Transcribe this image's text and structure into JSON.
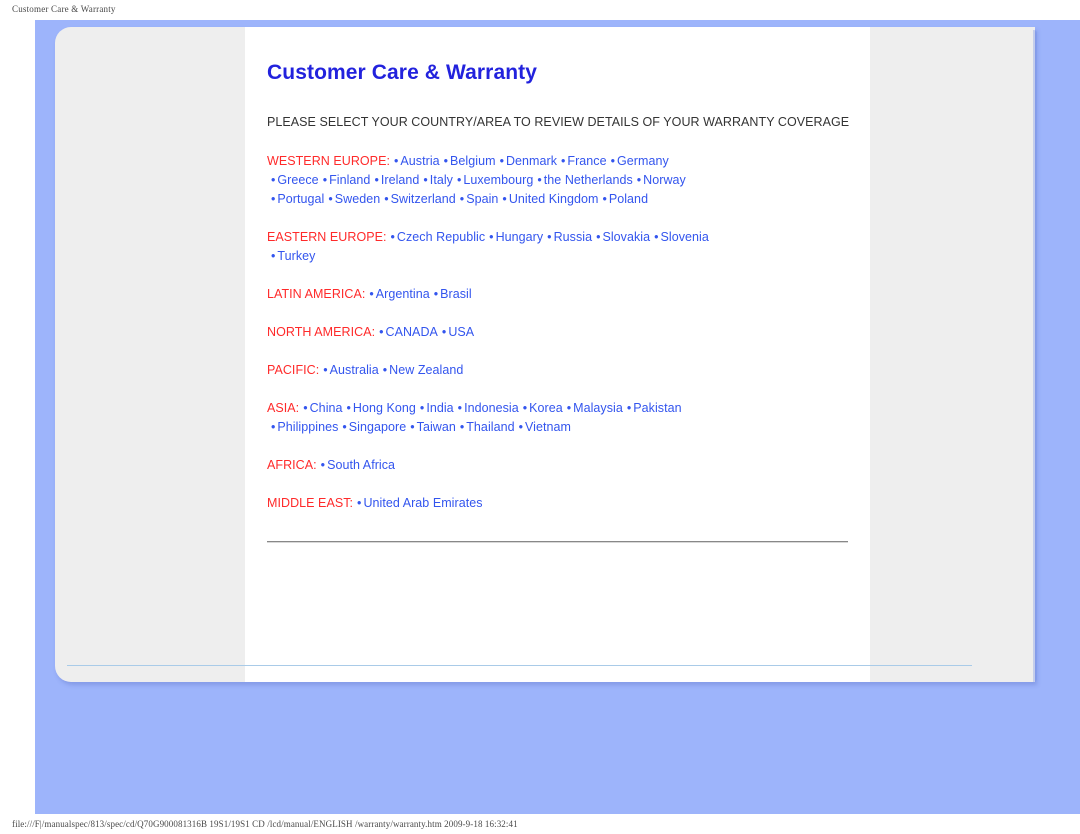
{
  "browser": {
    "header_title": "Customer Care & Warranty",
    "footer_text": "file:///F|/manualspec/813/spec/cd/Q70G900081316B 19S1/19S1 CD /lcd/manual/ENGLISH /warranty/warranty.htm 2009-9-18 16:32:41"
  },
  "colors": {
    "page_background": "#9db4fb",
    "card_background": "#eeeeee",
    "content_background": "#ffffff",
    "title": "#2222dd",
    "region_label": "#ff2a2a",
    "link": "#3355ee",
    "subtitle": "#333333",
    "rule": "#888888",
    "bottom_rule": "#a9cbe8"
  },
  "document": {
    "title": "Customer Care & Warranty",
    "subtitle": "PLEASE SELECT YOUR COUNTRY/AREA TO REVIEW DETAILS OF YOUR WARRANTY COVERAGE",
    "bullet": "•",
    "regions": [
      {
        "label": "WESTERN EUROPE:",
        "lines": [
          [
            "Austria",
            "Belgium",
            "Denmark",
            "France",
            "Germany"
          ],
          [
            "Greece",
            "Finland",
            "Ireland",
            "Italy",
            "Luxembourg",
            "the Netherlands",
            "Norway"
          ],
          [
            "Portugal",
            "Sweden",
            "Switzerland",
            "Spain",
            "United Kingdom",
            "Poland"
          ]
        ]
      },
      {
        "label": "EASTERN EUROPE:",
        "lines": [
          [
            "Czech Republic",
            "Hungary",
            "Russia",
            "Slovakia",
            "Slovenia"
          ],
          [
            "Turkey"
          ]
        ]
      },
      {
        "label": "LATIN AMERICA:",
        "lines": [
          [
            "Argentina",
            "Brasil"
          ]
        ]
      },
      {
        "label": "NORTH AMERICA:",
        "lines": [
          [
            "CANADA",
            "USA"
          ]
        ]
      },
      {
        "label": "PACIFIC:",
        "lines": [
          [
            "Australia",
            "New Zealand"
          ]
        ]
      },
      {
        "label": "ASIA:",
        "lines": [
          [
            "China",
            "Hong Kong",
            "India",
            "Indonesia",
            "Korea",
            "Malaysia",
            "Pakistan"
          ],
          [
            "Philippines",
            "Singapore",
            "Taiwan",
            "Thailand",
            "Vietnam"
          ]
        ]
      },
      {
        "label": "AFRICA:",
        "lines": [
          [
            "South Africa"
          ]
        ]
      },
      {
        "label": "MIDDLE EAST:",
        "lines": [
          [
            "United Arab Emirates"
          ]
        ]
      }
    ]
  }
}
